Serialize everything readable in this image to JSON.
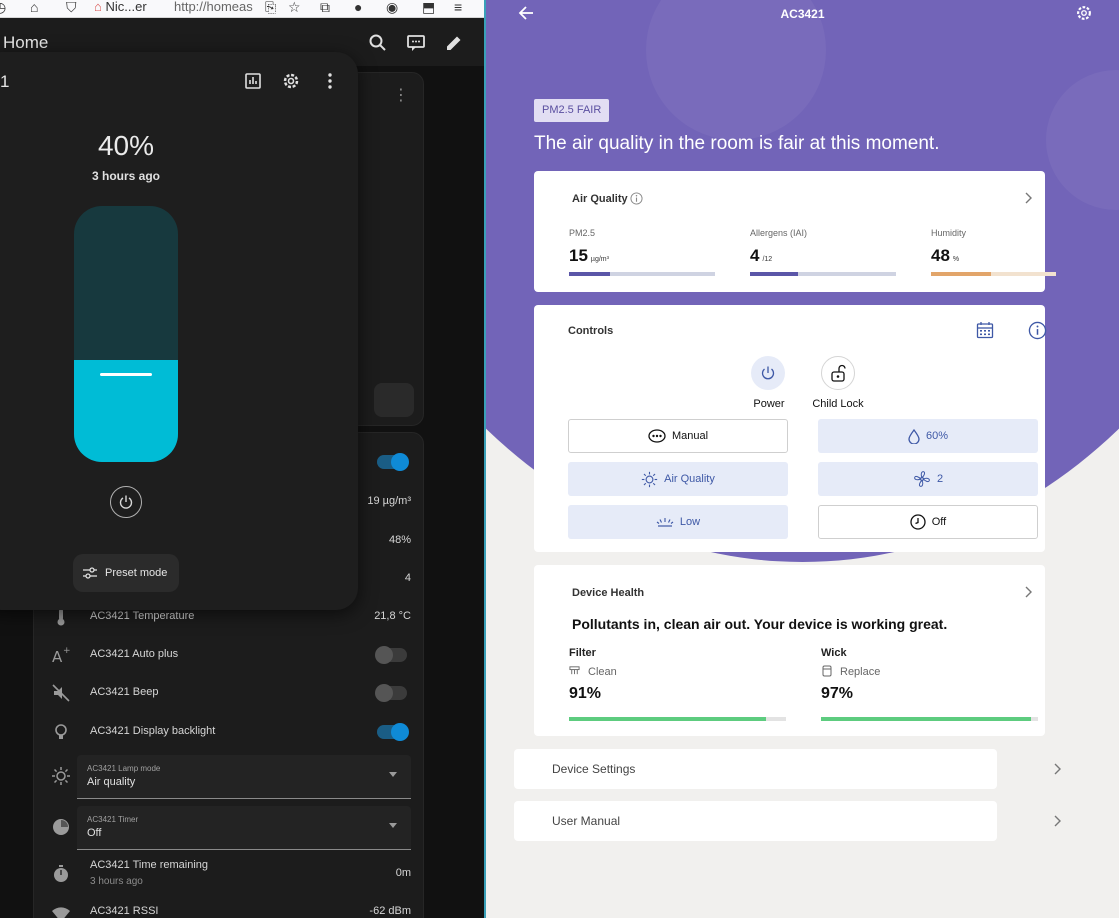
{
  "browser": {
    "tab_title": "Nic...er",
    "url": "http://homeas"
  },
  "ha": {
    "header_title": "Home",
    "dialog": {
      "title": "1",
      "percent": "40%",
      "last_changed": "3 hours ago",
      "level": 0.4,
      "preset_label": "Preset mode"
    },
    "values": {
      "pm25": "19 µg/m³",
      "humidity": "48%",
      "allergen": "4"
    },
    "entities": [
      {
        "name": "AC3421 Temperature",
        "value": "21,8 °C"
      },
      {
        "name": "AC3421 Auto plus",
        "toggle": "off"
      },
      {
        "name": "AC3421 Beep",
        "toggle": "off"
      },
      {
        "name": "AC3421 Display backlight",
        "toggle": "on"
      }
    ],
    "lamp_mode": {
      "label": "AC3421 Lamp mode",
      "value": "Air quality"
    },
    "timer": {
      "label": "AC3421 Timer",
      "value": "Off"
    },
    "time_remaining": {
      "name": "AC3421 Time remaining",
      "sub": "3 hours ago",
      "value": "0m"
    },
    "rssi": {
      "name": "AC3421 RSSI",
      "value": "-62 dBm"
    }
  },
  "app": {
    "title": "AC3421",
    "badge": "PM2.5 FAIR",
    "headline": "The air quality in the room is fair at this moment.",
    "air_quality": {
      "title": "Air Quality",
      "metrics": [
        {
          "label": "PM2.5",
          "value": "15",
          "unit": "µg/m³",
          "fill": 0.28,
          "color": "#5b56a8",
          "track": "#cfd3e2"
        },
        {
          "label": "Allergens (IAI)",
          "value": "4",
          "unit": "/12",
          "fill": 0.33,
          "color": "#5b56a8",
          "track": "#cfd3e2"
        },
        {
          "label": "Humidity",
          "value": "48",
          "unit": "%",
          "fill": 0.48,
          "color": "#e2a56a",
          "track": "#f2e2cf"
        }
      ]
    },
    "controls": {
      "title": "Controls",
      "power_label": "Power",
      "child_lock_label": "Child Lock",
      "pills": {
        "mode": "Manual",
        "humidity_target": "60%",
        "light": "Air Quality",
        "fan": "2",
        "brightness": "Low",
        "timer": "Off"
      }
    },
    "health": {
      "title": "Device Health",
      "message": "Pollutants in, clean air out. Your device is working great.",
      "filter": {
        "title": "Filter",
        "status": "Clean",
        "percent": "91%",
        "fill": 0.91
      },
      "wick": {
        "title": "Wick",
        "status": "Replace",
        "percent": "97%",
        "fill": 0.97
      },
      "bar_color": "#5dcc7f"
    },
    "menu": {
      "settings": "Device Settings",
      "manual": "User Manual"
    },
    "colors": {
      "purple": "#7264b8",
      "accent_blue": "#3e58a6"
    }
  }
}
